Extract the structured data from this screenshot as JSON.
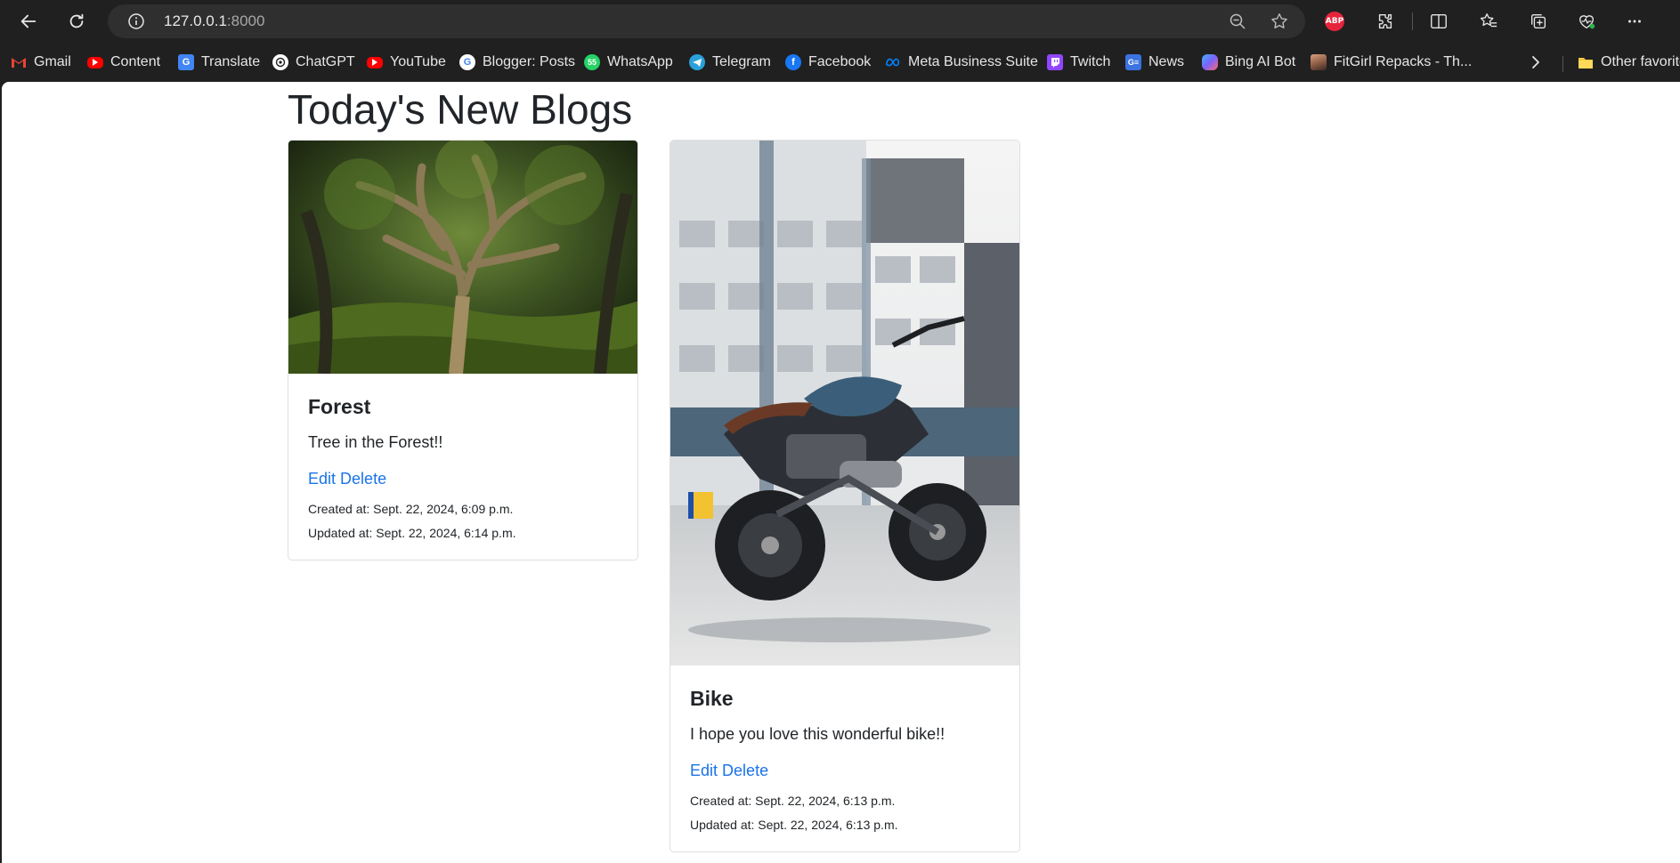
{
  "browser": {
    "url_host": "127.0.0.1",
    "url_port": ":8000",
    "abp_label": "ABP",
    "icons": [
      "back-icon",
      "reload-icon",
      "info-icon",
      "zoom-icon",
      "star-icon",
      "extensions-icon",
      "split-screen-icon",
      "favorites-icon",
      "collections-icon",
      "health-icon",
      "more-icon"
    ]
  },
  "bookmarks": {
    "items": [
      {
        "label": "Gmail",
        "icon": "gmail-icon",
        "color": "#ea4335"
      },
      {
        "label": "Content",
        "icon": "youtube-icon",
        "color": "#ff0000"
      },
      {
        "label": "Translate",
        "icon": "translate-icon",
        "color": "#4285f4"
      },
      {
        "label": "ChatGPT",
        "icon": "chatgpt-icon",
        "color": "#e6e6e6"
      },
      {
        "label": "YouTube",
        "icon": "youtube-icon",
        "color": "#ff0000"
      },
      {
        "label": "Blogger: Posts",
        "icon": "google-icon",
        "color": "#ffffff"
      },
      {
        "label": "WhatsApp",
        "icon": "whatsapp-icon",
        "color": "#25d366"
      },
      {
        "label": "Telegram",
        "icon": "telegram-icon",
        "color": "#2aa1da"
      },
      {
        "label": "Facebook",
        "icon": "facebook-icon",
        "color": "#1877f2"
      },
      {
        "label": "Meta Business Suite",
        "icon": "meta-icon",
        "color": "#0081fb"
      },
      {
        "label": "Twitch",
        "icon": "twitch-icon",
        "color": "#9146ff"
      },
      {
        "label": "News",
        "icon": "news-icon",
        "color": "#3b73e1"
      },
      {
        "label": "Bing AI Bot",
        "icon": "bing-icon",
        "color": "#7b61ff"
      },
      {
        "label": "FitGirl Repacks - Th...",
        "icon": "fitgirl-icon",
        "color": "#8a5a44"
      }
    ],
    "other_favorites": "Other favorites"
  },
  "page": {
    "title": "Today's New Blogs",
    "posts": [
      {
        "title": "Forest",
        "text": "Tree in the Forest!!",
        "edit": "Edit",
        "delete": "Delete",
        "created": "Created at: Sept. 22, 2024, 6:09 p.m.",
        "updated": "Updated at: Sept. 22, 2024, 6:14 p.m."
      },
      {
        "title": "Bike",
        "text": "I hope you love this wonderful bike!!",
        "edit": "Edit",
        "delete": "Delete",
        "created": "Created at: Sept. 22, 2024, 6:13 p.m.",
        "updated": "Updated at: Sept. 22, 2024, 6:13 p.m."
      }
    ],
    "link_color": "#1a73e8"
  }
}
